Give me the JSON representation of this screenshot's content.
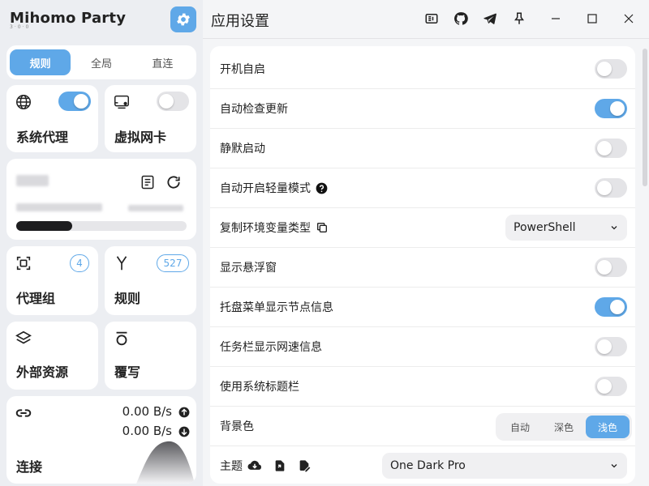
{
  "app": {
    "name": "Mihomo Party",
    "subtitle": "3·0·0"
  },
  "sidebar": {
    "modes": [
      {
        "label": "规则",
        "active": true
      },
      {
        "label": "全局",
        "active": false
      },
      {
        "label": "直连",
        "active": false
      }
    ],
    "system_proxy": {
      "label": "系统代理",
      "enabled": true
    },
    "tun": {
      "label": "虚拟网卡",
      "enabled": false
    },
    "profile": {
      "usage_fraction": 0.33
    },
    "proxy_groups": {
      "label": "代理组",
      "count": "4"
    },
    "rules": {
      "label": "规则",
      "count": "527"
    },
    "resources": {
      "label": "外部资源"
    },
    "override": {
      "label": "覆写"
    },
    "connections": {
      "label": "连接",
      "upload": "0.00 B/s",
      "download": "0.00 B/s"
    }
  },
  "page": {
    "title": "应用设置"
  },
  "settings": {
    "auto_start": {
      "label": "开机自启",
      "enabled": false
    },
    "auto_update": {
      "label": "自动检查更新",
      "enabled": true
    },
    "silent_start": {
      "label": "静默启动",
      "enabled": false
    },
    "light_mode": {
      "label": "自动开启轻量模式",
      "enabled": false
    },
    "env_type": {
      "label": "复制环境变量类型",
      "value": "PowerShell"
    },
    "floating": {
      "label": "显示悬浮窗",
      "enabled": false
    },
    "tray_nodes": {
      "label": "托盘菜单显示节点信息",
      "enabled": true
    },
    "taskbar_speed": {
      "label": "任务栏显示网速信息",
      "enabled": false
    },
    "system_titlebar": {
      "label": "使用系统标题栏",
      "enabled": false
    },
    "bg_color": {
      "label": "背景色",
      "options": [
        "自动",
        "深色",
        "浅色"
      ],
      "selected": "浅色"
    },
    "theme": {
      "label": "主题",
      "value": "One Dark Pro"
    }
  },
  "colors": {
    "accent": "#5fa8e8"
  }
}
